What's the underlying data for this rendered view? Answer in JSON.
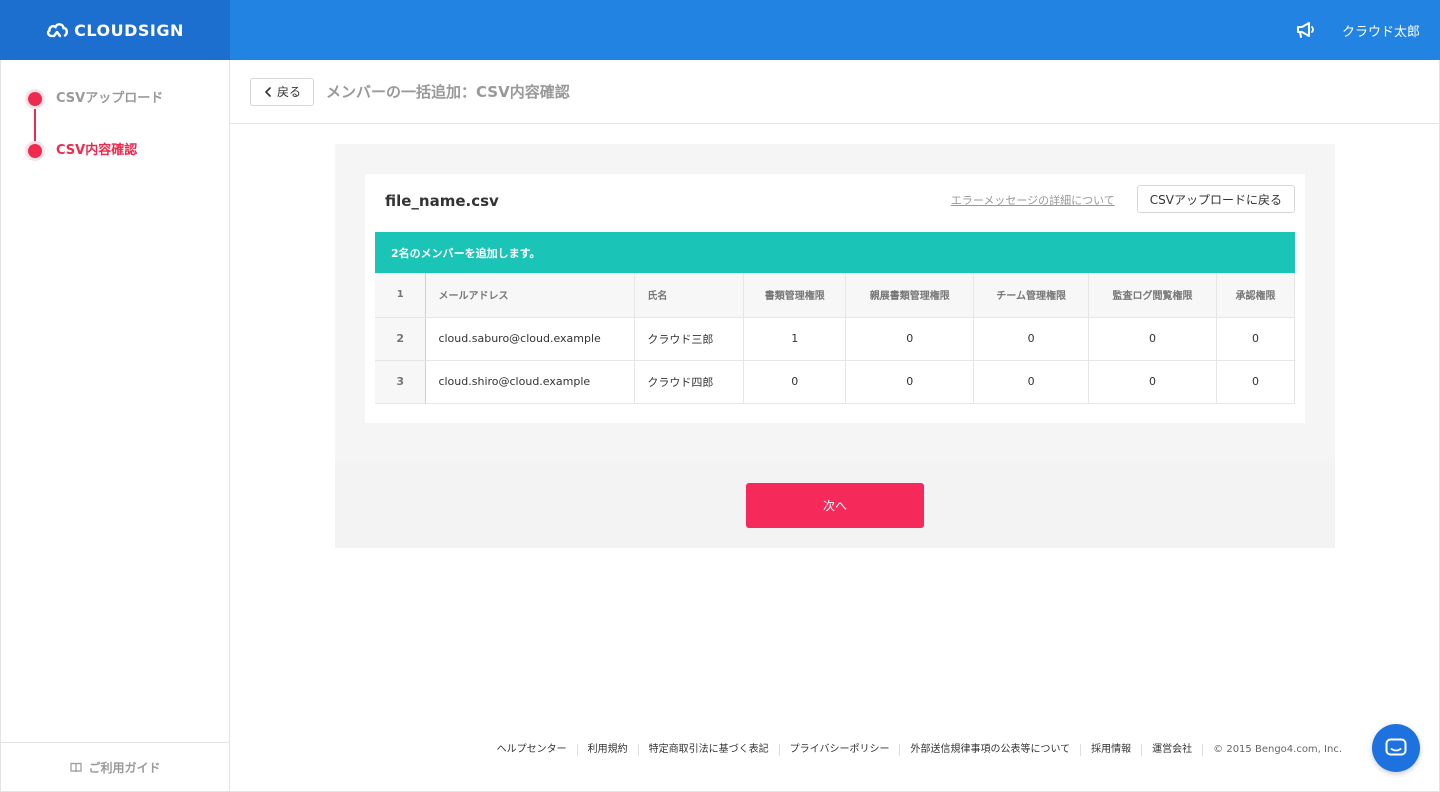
{
  "app": {
    "brand": "CLOUDSIGN",
    "user_name": "クラウド太郎"
  },
  "sidebar": {
    "steps": [
      {
        "label": "CSVアップロード",
        "state": "done"
      },
      {
        "label": "CSV内容確認",
        "state": "active"
      }
    ],
    "guide_label": "ご利用ガイド"
  },
  "header": {
    "back_label": "戻る",
    "title": "メンバーの一括追加：CSV内容確認"
  },
  "card": {
    "file_name": "file_name.csv",
    "error_link": "エラーメッセージの詳細について",
    "csv_back_label": "CSVアップロードに戻る",
    "notice": "2名のメンバーを追加します。"
  },
  "table": {
    "header_index": "1",
    "columns": [
      "メールアドレス",
      "氏名",
      "書類管理権限",
      "親展書類管理権限",
      "チーム管理権限",
      "監査ログ閲覧権限",
      "承認権限"
    ],
    "rows": [
      {
        "index": "2",
        "email": "cloud.saburo@cloud.example",
        "name": "クラウド三郎",
        "values": [
          "1",
          "0",
          "0",
          "0",
          "0"
        ]
      },
      {
        "index": "3",
        "email": "cloud.shiro@cloud.example",
        "name": "クラウド四郎",
        "values": [
          "0",
          "0",
          "0",
          "0",
          "0"
        ]
      }
    ]
  },
  "actions": {
    "next_label": "次へ"
  },
  "footer": {
    "links": [
      "ヘルプセンター",
      "利用規約",
      "特定商取引法に基づく表記",
      "プライバシーポリシー",
      "外部送信規律事項の公表等について",
      "採用情報",
      "運営会社"
    ],
    "copyright": "© 2015 Bengo4.com, Inc."
  },
  "colors": {
    "topbar": "#2383e2",
    "logo_bg": "#1c6fcf",
    "accent": "#f0294e",
    "notice": "#1ac4b7",
    "next_button": "#f5295a",
    "chat": "#1d72e0"
  },
  "icons": {
    "logo": "cloud-logo-icon",
    "notification": "megaphone-icon",
    "back": "chevron-left-icon",
    "guide": "book-icon",
    "chat": "chat-icon"
  }
}
